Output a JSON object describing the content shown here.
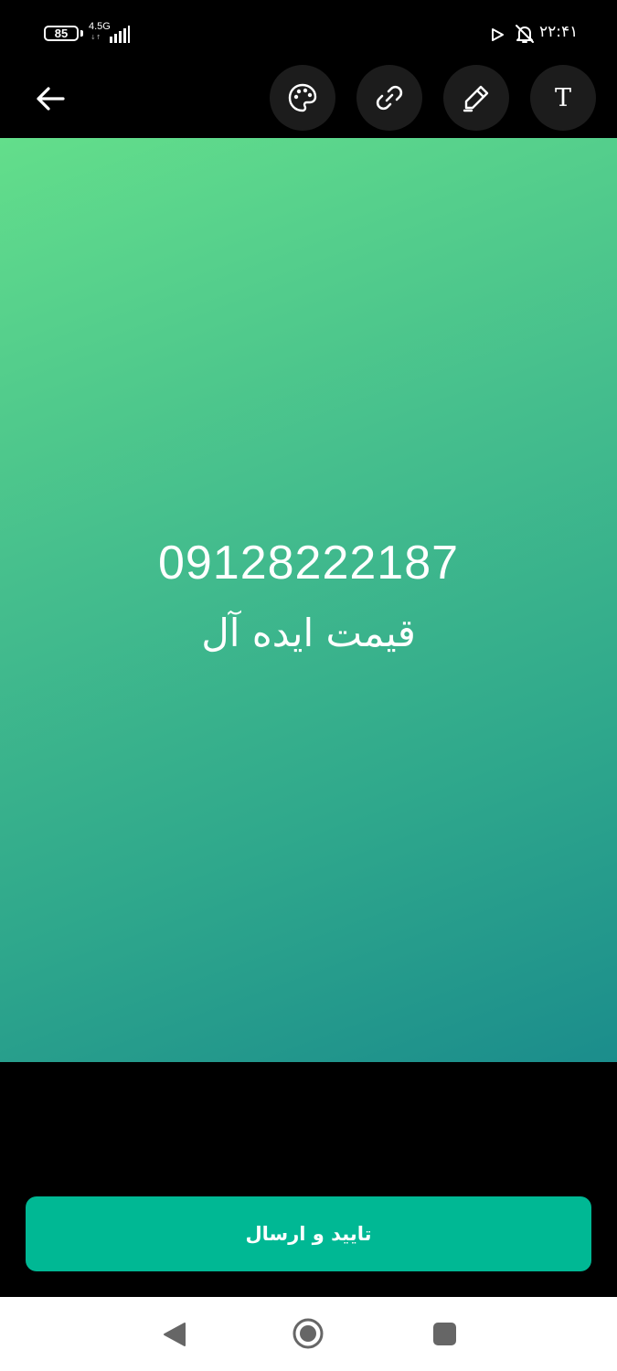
{
  "status_bar": {
    "battery_level": "85",
    "network_type": "4.5G",
    "network_arrows": "↓↑",
    "time": "۲۲:۴۱",
    "icons": [
      "battery-icon",
      "signal-icon",
      "play-icon",
      "bell-off-icon"
    ]
  },
  "toolbar": {
    "back_icon": "arrow-left-icon",
    "tools": [
      "palette-icon",
      "link-icon",
      "pen-icon",
      "text-icon"
    ],
    "text_tool_glyph": "T"
  },
  "story": {
    "phone": "09128222187",
    "caption": "قیمت ایده آل",
    "gradient_colors": [
      "#63de8b",
      "#1b8d8c"
    ]
  },
  "submit": {
    "label": "تایید و ارسال",
    "color": "#00b894"
  },
  "nav_bar": {
    "icons": [
      "nav-back-icon",
      "nav-home-icon",
      "nav-recents-icon"
    ]
  }
}
